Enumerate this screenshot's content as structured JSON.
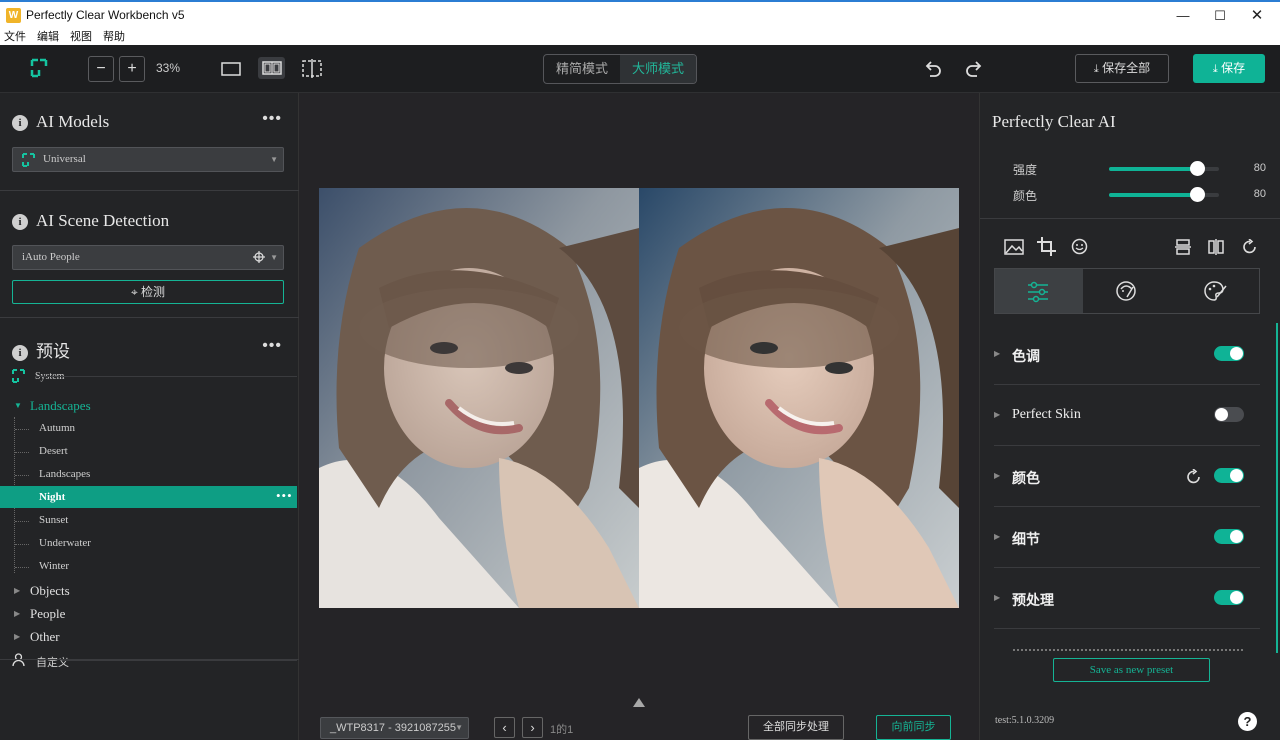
{
  "window": {
    "title": "Perfectly Clear Workbench v5",
    "app_icon": "W"
  },
  "menu": [
    "文件",
    "编辑",
    "视图",
    "帮助"
  ],
  "toolbar": {
    "zoom": "33%",
    "mode_simple": "精简模式",
    "mode_full": "大师模式",
    "save_all": "保存全部",
    "save": "保存"
  },
  "left": {
    "ai_models": {
      "title": "AI Models",
      "selected": "Universal"
    },
    "scene": {
      "title": "AI Scene Detection",
      "selected": "iAuto People",
      "detect_button": "检测"
    },
    "presets": {
      "title": "预设",
      "system": "System",
      "landscapes": "Landscapes",
      "landscape_items": [
        "Autumn",
        "Desert",
        "Landscapes",
        "Night",
        "Sunset",
        "Underwater",
        "Winter"
      ],
      "objects": "Objects",
      "people": "People",
      "other": "Other",
      "custom": "自定义"
    }
  },
  "bottom": {
    "file": "_WTP8317 - 3921087255",
    "page": "1的1",
    "sync_all": "全部同步处理",
    "sync_forward": "向前同步"
  },
  "right": {
    "title": "Perfectly Clear AI",
    "sliders": [
      {
        "label": "强度",
        "value": 80
      },
      {
        "label": "颜色",
        "value": 80
      }
    ],
    "sections": [
      {
        "label": "色调",
        "on": true
      },
      {
        "label": "Perfect Skin",
        "on": false
      },
      {
        "label": "颜色",
        "on": true
      },
      {
        "label": "细节",
        "on": true
      },
      {
        "label": "预处理",
        "on": true
      }
    ],
    "save_preset": "Save as new preset",
    "version": "test:5.1.0.3209"
  },
  "colors": {
    "accent": "#0fb396",
    "background": "#232426"
  }
}
